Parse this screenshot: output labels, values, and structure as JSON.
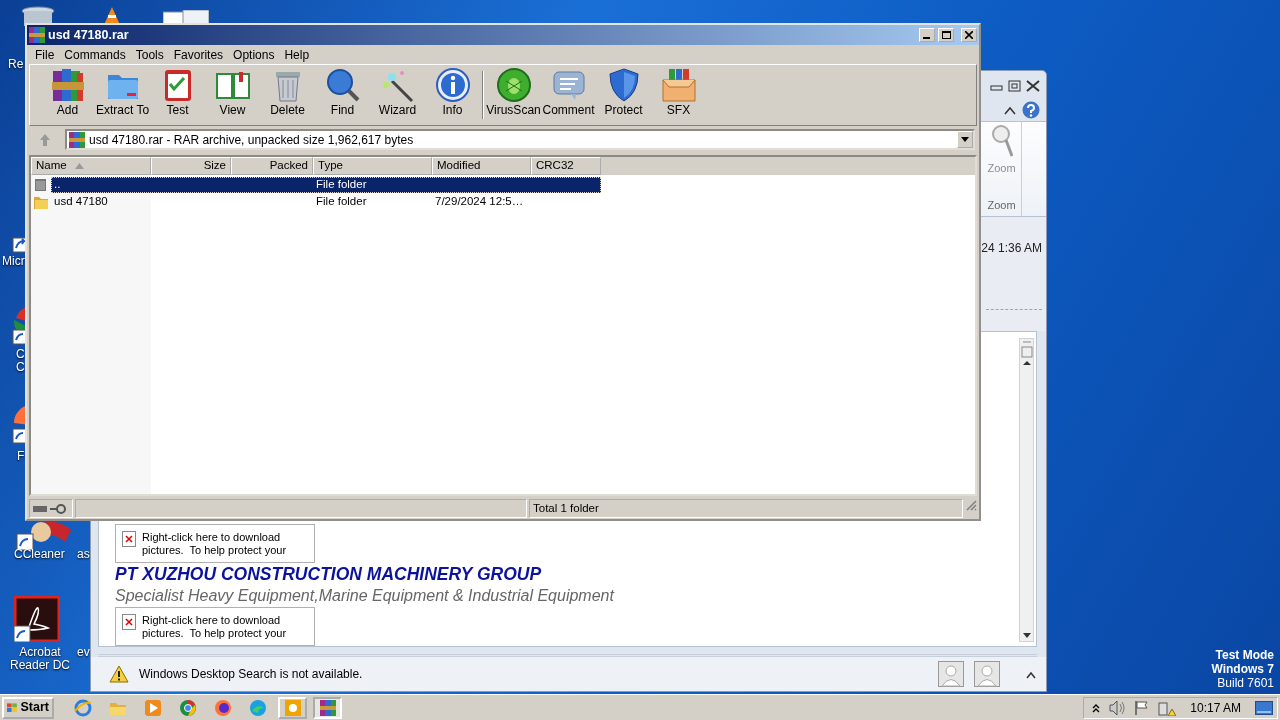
{
  "desktop": {
    "icons": [
      {
        "label": "Re"
      },
      {
        "label": "Micr"
      },
      {
        "label": "C\nC"
      },
      {
        "label": "F"
      },
      {
        "label": "CCleaner"
      },
      {
        "label": "as"
      },
      {
        "label": "Acrobat\nReader DC"
      },
      {
        "label": "ev"
      }
    ],
    "system_watermark": [
      "Test Mode",
      "Windows 7",
      "Build 7601"
    ]
  },
  "outlook": {
    "ribbon_button": "Zoom",
    "ribbon_group": "Zoom",
    "received": "24 1:36 AM",
    "message": [
      {
        "kind": "image_placeholder",
        "text": "Right-click here to download pictures.  To help protect your"
      },
      {
        "kind": "heading",
        "text": "PT XUZHOU CONSTRUCTION MACHINERY GROUP"
      },
      {
        "kind": "subheading",
        "text": "Specialist Heavy Equipment,Marine Equipment & Industrial Equipment"
      },
      {
        "kind": "image_placeholder",
        "text": "Right-click here to download pictures.  To help protect your"
      }
    ],
    "notice": "Windows Desktop Search is not available."
  },
  "winrar": {
    "title": "usd 47180.rar",
    "menu": [
      "File",
      "Commands",
      "Tools",
      "Favorites",
      "Options",
      "Help"
    ],
    "toolbar": [
      [
        {
          "label": "Add"
        },
        {
          "label": "Extract To"
        },
        {
          "label": "Test"
        },
        {
          "label": "View"
        },
        {
          "label": "Delete"
        },
        {
          "label": "Find"
        },
        {
          "label": "Wizard"
        },
        {
          "label": "Info"
        }
      ],
      [
        {
          "label": "VirusScan"
        },
        {
          "label": "Comment"
        },
        {
          "label": "Protect"
        },
        {
          "label": "SFX"
        }
      ]
    ],
    "address": "usd 47180.rar - RAR archive, unpacked size 1,962,617 bytes",
    "columns": [
      {
        "label": "Name",
        "sorted": true
      },
      {
        "label": "Size",
        "sorted": false
      },
      {
        "label": "Packed",
        "sorted": false
      },
      {
        "label": "Type",
        "sorted": false
      },
      {
        "label": "Modified",
        "sorted": false
      },
      {
        "label": "CRC32",
        "sorted": false
      }
    ],
    "rows": [
      {
        "kind": "parent",
        "name": "..",
        "type": "File folder",
        "selected": true
      },
      {
        "kind": "folder",
        "name": "usd 47180",
        "type": "File folder",
        "modified": "7/29/2024 12:5…",
        "selected": false
      }
    ],
    "status": "Total 1 folder"
  },
  "taskbar": {
    "start": "Start",
    "apps": [
      {
        "running": false,
        "selected": false
      },
      {
        "running": false,
        "selected": false
      },
      {
        "running": false,
        "selected": false
      },
      {
        "running": false,
        "selected": false
      },
      {
        "running": false,
        "selected": false
      },
      {
        "running": false,
        "selected": false
      },
      {
        "running": true,
        "selected": false
      },
      {
        "running": true,
        "selected": true
      }
    ],
    "clock": "10:17 AM"
  }
}
